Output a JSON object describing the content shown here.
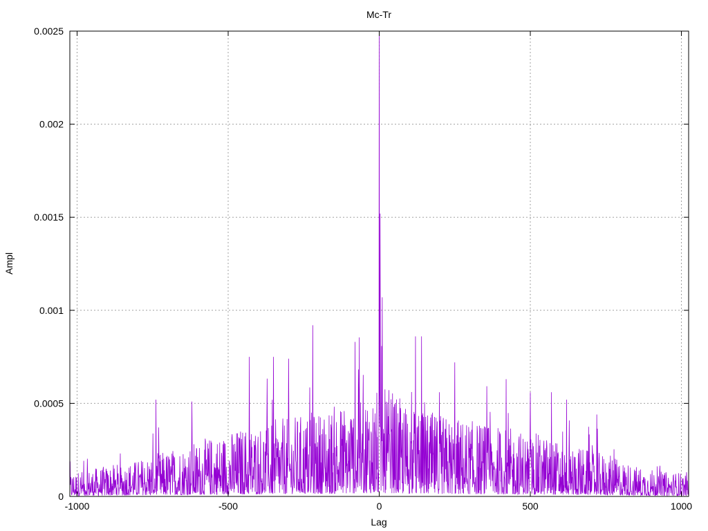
{
  "chart_data": {
    "type": "line",
    "title": "Mc-Tr",
    "xlabel": "Lag",
    "ylabel": "Ampl",
    "xlim": [
      -1024,
      1024
    ],
    "ylim": [
      0,
      0.0025
    ],
    "xticks": [
      -1000,
      -500,
      0,
      500,
      1000
    ],
    "xtick_labels": [
      "-1000",
      "-500",
      "0",
      "500",
      "1000"
    ],
    "yticks": [
      0,
      0.0005,
      0.001,
      0.0015,
      0.002,
      0.0025
    ],
    "ytick_labels": [
      "0",
      "0.0005",
      "0.001",
      "0.0015",
      "0.002",
      "0.0025"
    ],
    "grid": true,
    "legend": "none",
    "series_color": "#9400d3",
    "series": [
      {
        "x": [
          -1024,
          -960,
          -900,
          -850,
          -800,
          -750,
          -700,
          -650,
          -600,
          -550,
          -500,
          -450,
          -400,
          -350,
          -300,
          -250,
          -200,
          -150,
          -100,
          -50,
          0,
          50,
          100,
          150,
          200,
          250,
          300,
          350,
          400,
          450,
          500,
          550,
          600,
          650,
          700,
          750,
          800,
          850,
          900,
          950,
          1024
        ],
        "values": [
          8e-05,
          9e-05,
          0.0001,
          0.00011,
          0.00012,
          0.00014,
          0.00015,
          0.00017,
          0.00018,
          0.0002,
          0.00021,
          0.00023,
          0.00024,
          0.00025,
          0.00026,
          0.00027,
          0.00028,
          0.0003,
          0.00032,
          0.00035,
          0.0025,
          0.00033,
          0.0003,
          0.00028,
          0.00027,
          0.00026,
          0.00025,
          0.00024,
          0.00023,
          0.00022,
          0.00021,
          0.0002,
          0.00018,
          0.00017,
          0.00015,
          0.00014,
          0.00012,
          0.0001,
          9e-05,
          8e-05,
          8e-05
        ],
        "peaks": [
          {
            "x": -739,
            "y": 0.00052
          },
          {
            "x": -620,
            "y": 0.00051
          },
          {
            "x": -430,
            "y": 0.00075
          },
          {
            "x": -350,
            "y": 0.00075
          },
          {
            "x": -300,
            "y": 0.00074
          },
          {
            "x": -220,
            "y": 0.00092
          },
          {
            "x": -80,
            "y": 0.00083
          },
          {
            "x": 0,
            "y": 0.0025
          },
          {
            "x": 3,
            "y": 0.00152
          },
          {
            "x": 10,
            "y": 0.00107
          },
          {
            "x": 120,
            "y": 0.00086
          },
          {
            "x": 140,
            "y": 0.00086
          },
          {
            "x": 250,
            "y": 0.00072
          },
          {
            "x": 420,
            "y": 0.00063
          },
          {
            "x": 500,
            "y": 0.00056
          },
          {
            "x": 570,
            "y": 0.00056
          },
          {
            "x": 620,
            "y": 0.00052
          },
          {
            "x": 720,
            "y": 0.00044
          }
        ]
      }
    ]
  }
}
